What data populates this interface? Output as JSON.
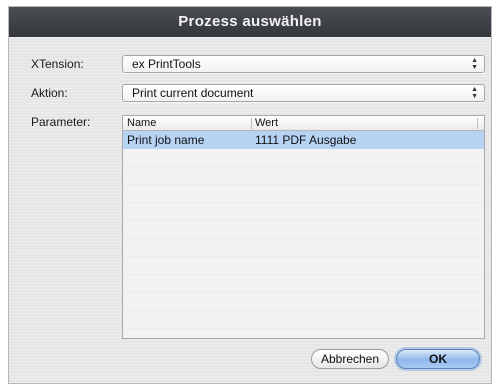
{
  "dialog": {
    "title": "Prozess auswählen"
  },
  "form": {
    "xtension_label": "XTension:",
    "xtension_value": "ex PrintTools",
    "aktion_label": "Aktion:",
    "aktion_value": "Print current document",
    "parameter_label": "Parameter:"
  },
  "table": {
    "columns": [
      "Name",
      "Wert"
    ],
    "rows": [
      {
        "name": "Print job name",
        "wert": "1111 PDF Ausgabe",
        "selected": true
      }
    ]
  },
  "buttons": {
    "cancel_label": "Abbrechen",
    "ok_label": "OK"
  },
  "icons": {
    "popup_arrows": "updown-chevron-icon"
  },
  "colors": {
    "titlebar": "#3d4046",
    "selection": "#b7d3f4",
    "default_button": "#8fb8ea"
  }
}
